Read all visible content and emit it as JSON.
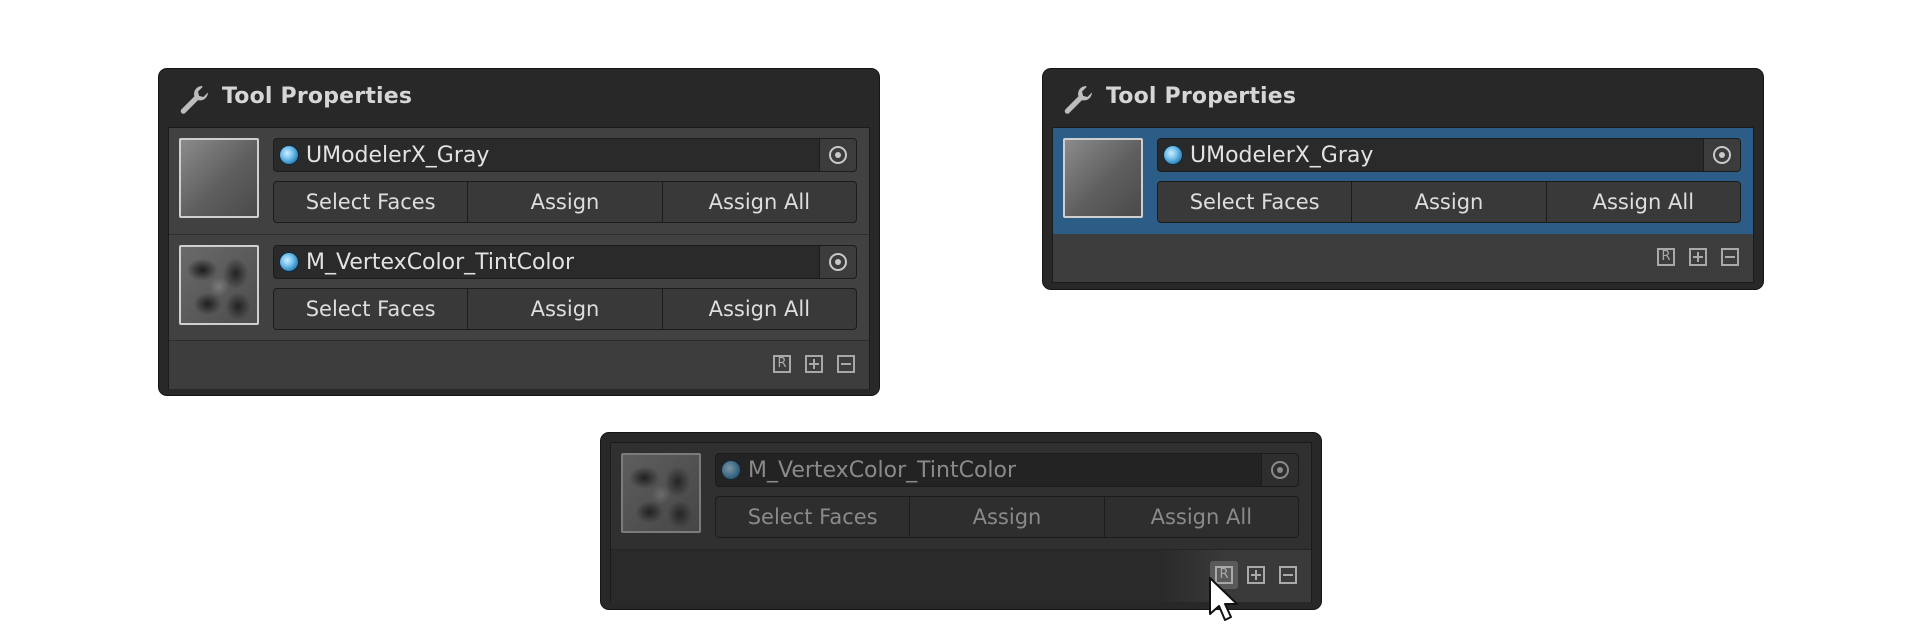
{
  "panels": [
    {
      "title": "Tool Properties",
      "materials": [
        {
          "name": "UModelerX_Gray",
          "buttons": [
            "Select Faces",
            "Assign",
            "Assign All"
          ]
        },
        {
          "name": "M_VertexColor_TintColor",
          "buttons": [
            "Select Faces",
            "Assign",
            "Assign All"
          ]
        }
      ],
      "footer_icons": [
        "reset-icon",
        "add-icon",
        "remove-icon"
      ]
    },
    {
      "title": "Tool Properties",
      "selected_row": 0,
      "materials": [
        {
          "name": "UModelerX_Gray",
          "buttons": [
            "Select Faces",
            "Assign",
            "Assign All"
          ]
        }
      ],
      "footer_icons": [
        "reset-icon",
        "add-icon",
        "remove-icon"
      ]
    },
    {
      "state": "disabled",
      "materials": [
        {
          "name": "M_VertexColor_TintColor",
          "buttons": [
            "Select Faces",
            "Assign",
            "Assign All"
          ]
        }
      ],
      "footer_icons": [
        "reset-icon",
        "add-icon",
        "remove-icon"
      ],
      "hovered_icon": "reset-icon"
    }
  ],
  "colors": {
    "panel_bg": "#282828",
    "list_bg": "#414141",
    "selection": "#2c5d87",
    "text": "#e2e2e2"
  },
  "icons": {
    "header": "wrench-icon",
    "material": "material-sphere-icon",
    "picker": "object-picker-icon",
    "pointer": "mouse-cursor-icon"
  }
}
